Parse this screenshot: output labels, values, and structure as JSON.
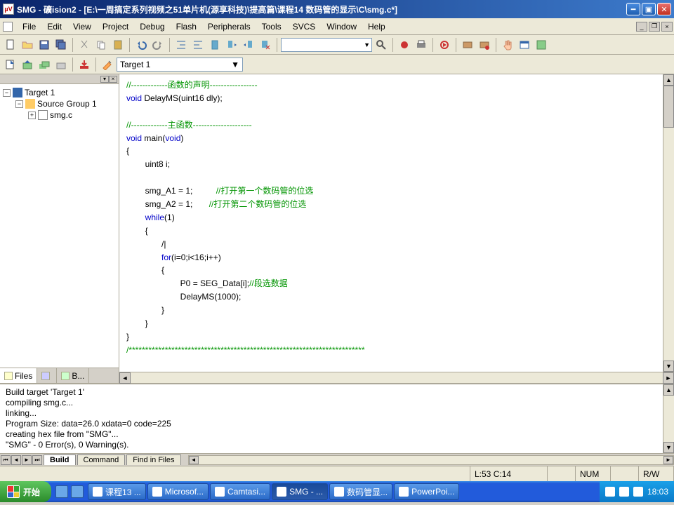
{
  "window": {
    "app_icon_text": "µV",
    "title": "SMG - 礦ision2 - [E:\\一周搞定系列视频之51单片机(源享科技)\\提高篇\\课程14 数码管的显示\\C\\smg.c*]"
  },
  "menu": {
    "items": [
      "File",
      "Edit",
      "View",
      "Project",
      "Debug",
      "Flash",
      "Peripherals",
      "Tools",
      "SVCS",
      "Window",
      "Help"
    ]
  },
  "toolbar2": {
    "target": "Target 1"
  },
  "project": {
    "root": "Target 1",
    "group": "Source Group 1",
    "file": "smg.c",
    "tabs": {
      "files": "Files",
      "regs": "",
      "books": "B..."
    }
  },
  "code": {
    "l1a": "//-------------",
    "l1b": "函数的声明",
    "l1c": "-----------------",
    "l2a": "void",
    "l2b": " DelayMS(uint16 dly);",
    "l3": "",
    "l4a": "//-------------",
    "l4b": "主函数",
    "l4c": "---------------------",
    "l5a": "void",
    "l5b": " main(",
    "l5c": "void",
    "l5d": ")",
    "l6": "{",
    "l7": "        uint8 i;",
    "l8": "",
    "l9a": "        smg_A1 = 1;          ",
    "l9b": "//打开第一个数码管的位选",
    "l10a": "        smg_A2 = 1;       ",
    "l10b": "//打开第二个数码管的位选",
    "l11a": "        ",
    "l11b": "while",
    "l11c": "(1)",
    "l12": "        {",
    "l12x": "               /|",
    "l13a": "               ",
    "l13b": "for",
    "l13c": "(i=0;i<16;i++)",
    "l14": "               {",
    "l15a": "                       P0 = SEG_Data[i];",
    "l15b": "//段选数据",
    "l16": "                       DelayMS(1000);",
    "l17": "               }",
    "l18": "        }",
    "l19": "}",
    "l20": "/************************************************************************"
  },
  "output": {
    "l1": "Build target 'Target 1'",
    "l2": "compiling smg.c...",
    "l3": "linking...",
    "l4": "Program Size: data=26.0 xdata=0 code=225",
    "l5": "creating hex file from \"SMG\"...",
    "l6": "\"SMG\" - 0 Error(s), 0 Warning(s).",
    "tabs": {
      "build": "Build",
      "command": "Command",
      "find": "Find in Files"
    }
  },
  "status": {
    "pos": "L:53 C:14",
    "num": "NUM",
    "rw": "R/W"
  },
  "taskbar": {
    "start": "开始",
    "items": [
      "课程13 ...",
      "Microsof...",
      "Camtasi...",
      "SMG - ...",
      "数码管显...",
      "PowerPoi..."
    ],
    "active_index": 3,
    "clock": "18:03"
  }
}
